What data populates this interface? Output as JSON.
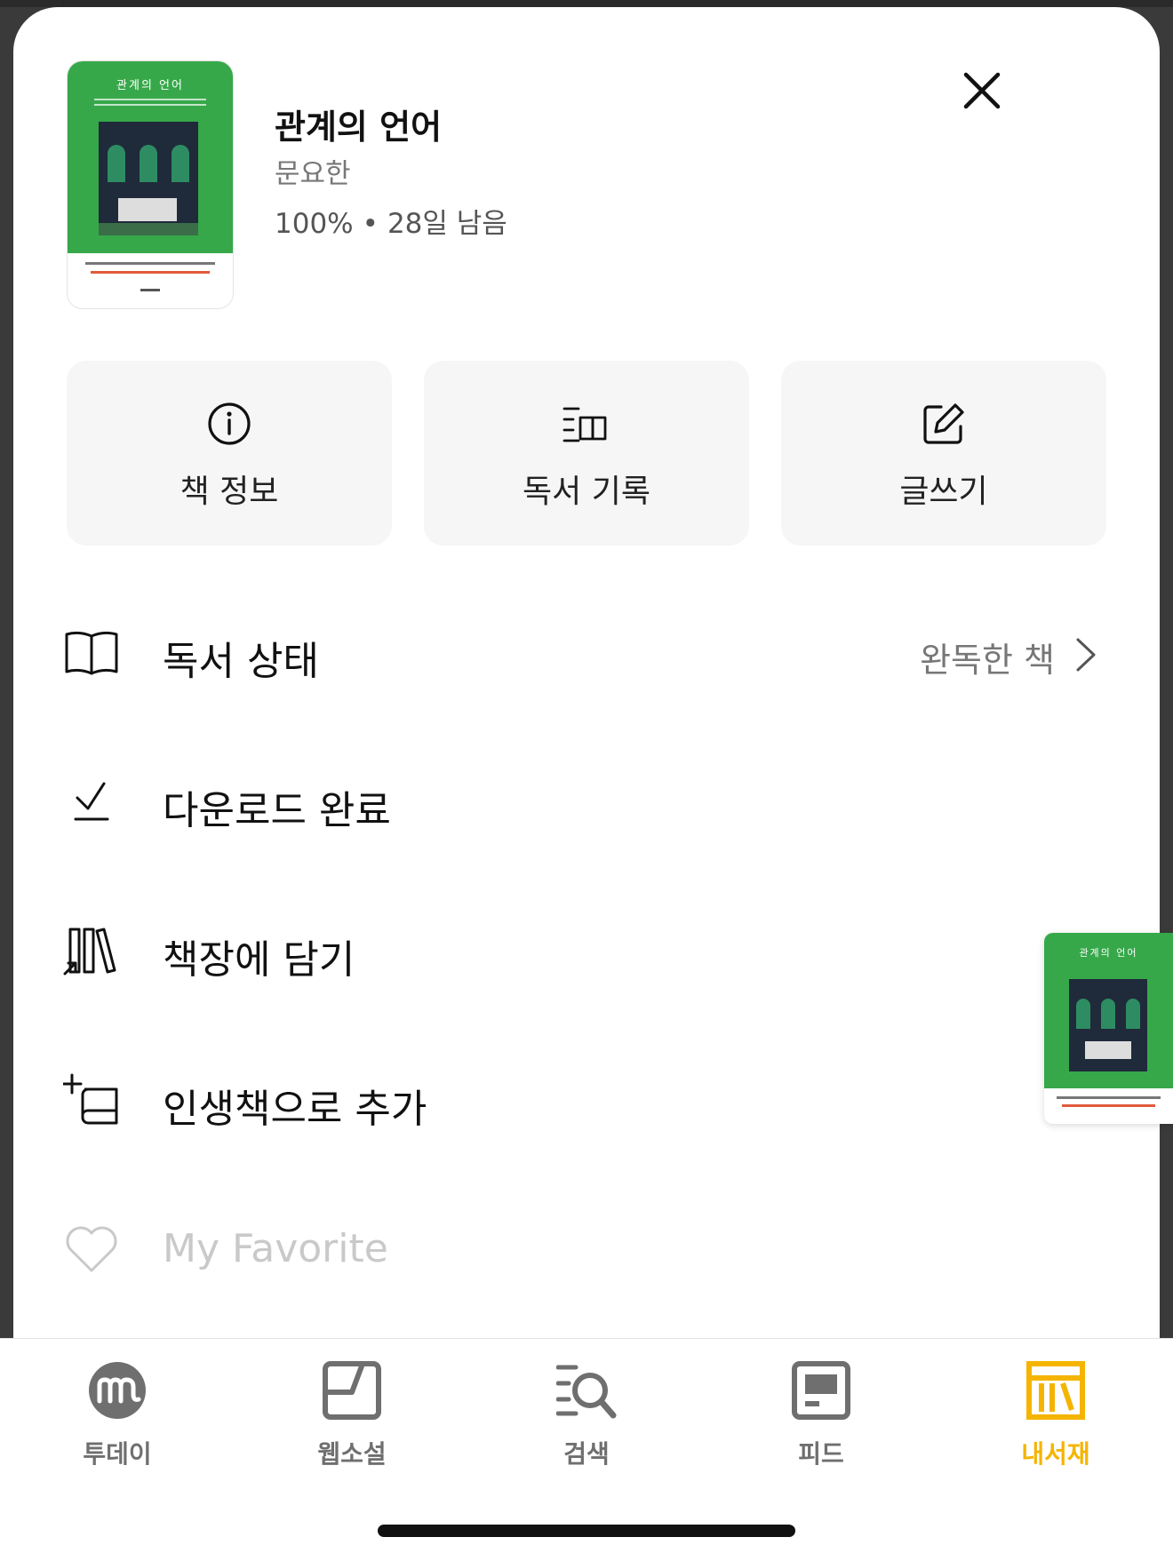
{
  "book": {
    "title": "관계의 언어",
    "author": "문요한",
    "progress": "100%",
    "separator": "•",
    "remaining": "28일 남음",
    "cover_title": "관계의 언어"
  },
  "actions": [
    {
      "label": "책 정보",
      "icon": "info-circle-icon"
    },
    {
      "label": "독서 기록",
      "icon": "reading-log-icon"
    },
    {
      "label": "글쓰기",
      "icon": "edit-icon"
    }
  ],
  "menu": {
    "reading_status": {
      "label": "독서 상태",
      "value": "완독한 책",
      "icon": "open-book-icon"
    },
    "download": {
      "label": "다운로드 완료",
      "icon": "download-check-icon"
    },
    "bookshelf": {
      "label": "책장에 담기",
      "icon": "bookshelf-icon"
    },
    "life_book": {
      "label": "인생책으로 추가",
      "icon": "add-book-icon"
    },
    "favorite": {
      "label": "My Favorite",
      "icon": "heart-icon"
    }
  },
  "tabs": [
    {
      "label": "투데이",
      "icon": "today-m-icon",
      "active": false
    },
    {
      "label": "웹소설",
      "icon": "webnovel-icon",
      "active": false
    },
    {
      "label": "검색",
      "icon": "search-list-icon",
      "active": false
    },
    {
      "label": "피드",
      "icon": "feed-icon",
      "active": false
    },
    {
      "label": "내서재",
      "icon": "library-icon",
      "active": true
    }
  ],
  "colors": {
    "accent": "#f5b400",
    "cover_green": "#36a84a",
    "card_bg": "#f5f6f5",
    "muted_text": "#c9c9c9"
  }
}
